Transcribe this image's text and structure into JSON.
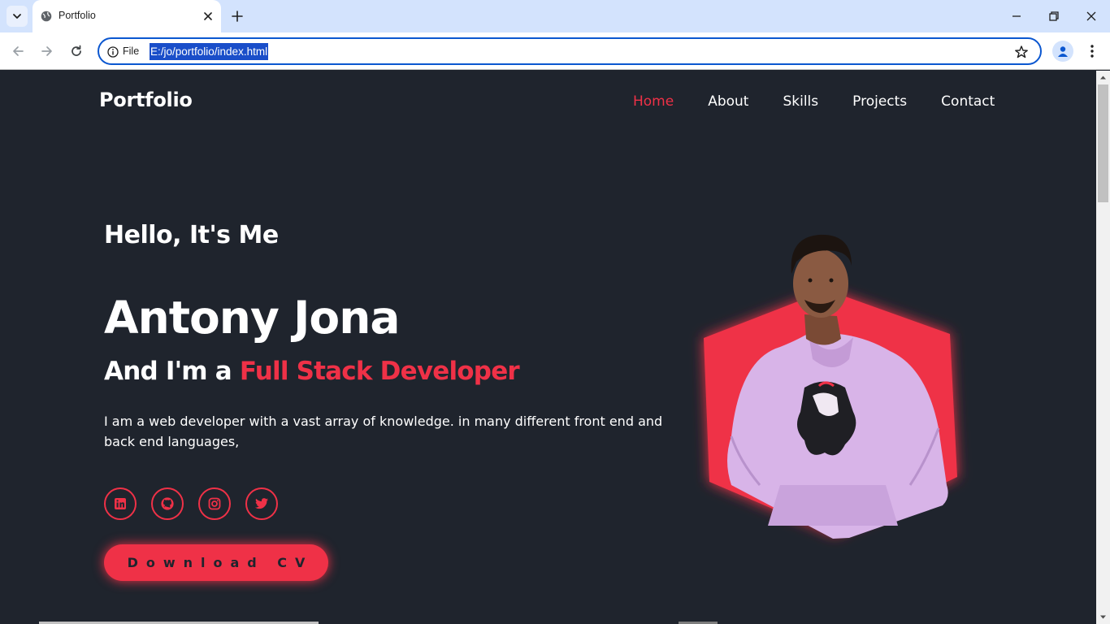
{
  "browser": {
    "tab_title": "Portfolio",
    "url_scheme": "File",
    "url": "E:/jo/portfolio/index.html",
    "accent_color": "#0b57d0"
  },
  "site": {
    "logo": "Portfolio",
    "nav": [
      "Home",
      "About",
      "Skills",
      "Projects",
      "Contact"
    ],
    "active_nav": "Home",
    "accent_color": "#ef3147",
    "background_color": "#1f242d"
  },
  "hero": {
    "greeting": "Hello, It's Me",
    "name": "Antony Jona",
    "role_prefix": "And I'm a",
    "role": "Full Stack Developer",
    "description": "I am a web developer with a vast array of knowledge. in many different front end and back end languages,",
    "socials": [
      "linkedin-icon",
      "github-icon",
      "instagram-icon",
      "twitter-icon"
    ],
    "cv_button": "Download CV"
  }
}
